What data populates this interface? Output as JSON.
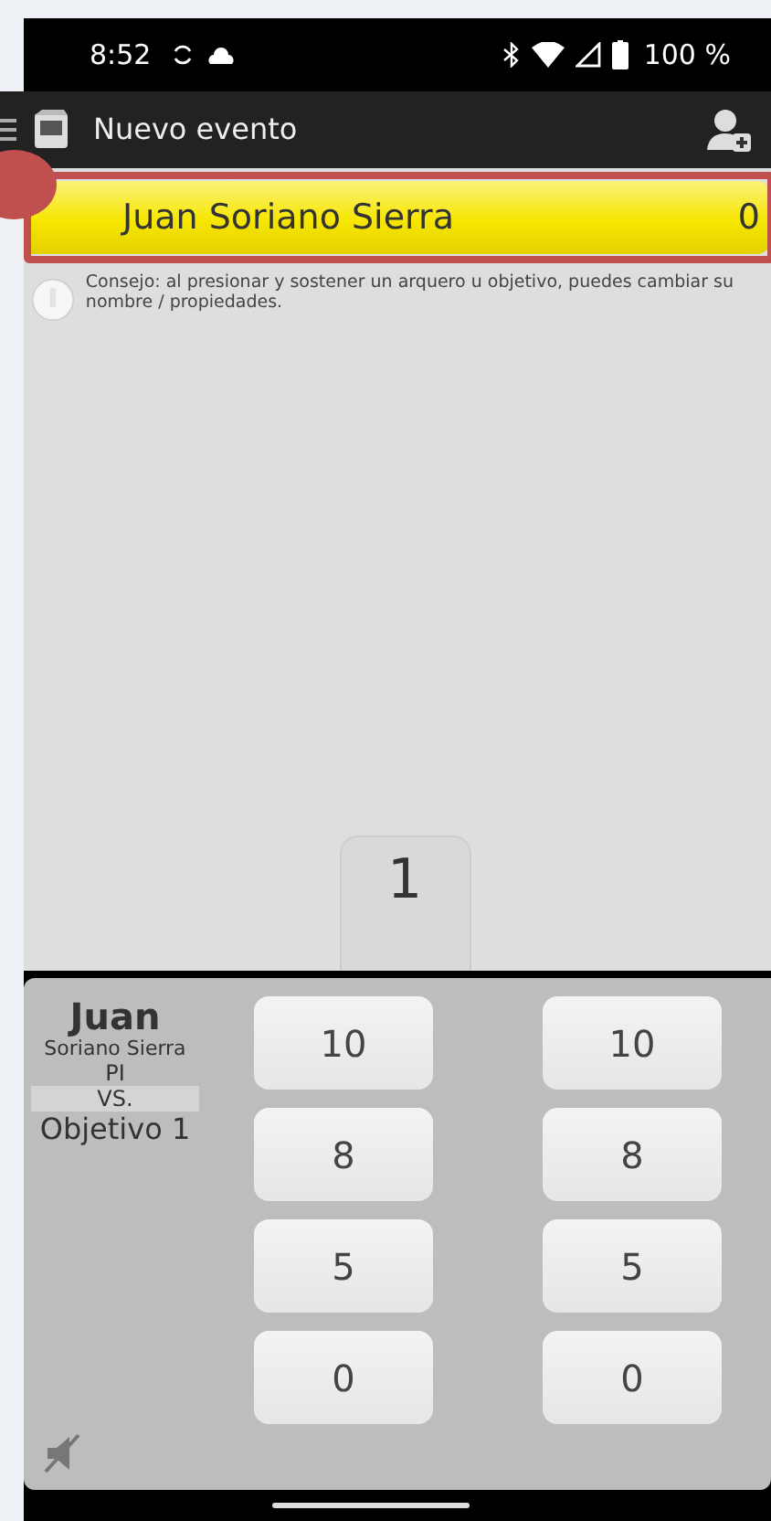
{
  "status_bar": {
    "time": "8:52",
    "battery": "100 %"
  },
  "app_bar": {
    "title": "Nuevo evento"
  },
  "archers": [
    {
      "name": "Juan Soriano Sierra",
      "score": "0",
      "selected": true,
      "highlighted": true
    }
  ],
  "tip": "Consejo: al presionar y sostener un arquero u objetivo, puedes cambiar su nombre / propiedades.",
  "tabs": [
    {
      "label": "1",
      "selected": true
    }
  ],
  "scoring": {
    "first_name": "Juan",
    "last_name": "Soriano Sierra",
    "class": "PI",
    "versus": "VS.",
    "target": "Objetivo 1",
    "columns": [
      [
        "10",
        "8",
        "5",
        "0"
      ],
      [
        "10",
        "8",
        "5",
        "0"
      ]
    ]
  },
  "sound": {
    "muted": true
  }
}
